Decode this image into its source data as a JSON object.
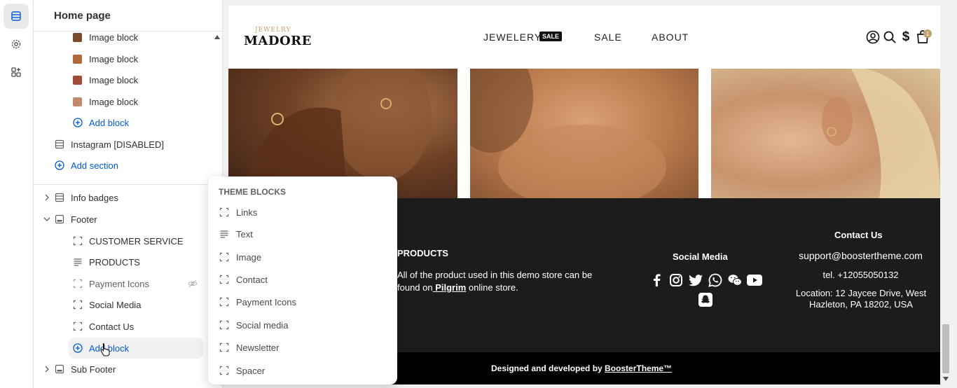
{
  "sidebar": {
    "title": "Home page",
    "image_blocks": [
      {
        "label": "Image block",
        "color": "#7a4a2a"
      },
      {
        "label": "Image block",
        "color": "#b0683a"
      },
      {
        "label": "Image block",
        "color": "#a34a36"
      },
      {
        "label": "Image block",
        "color": "#c08a6a"
      }
    ],
    "add_block_top": "Add block",
    "instagram": "Instagram [DISABLED]",
    "add_section": "Add section",
    "info_badges": "Info badges",
    "footer": "Footer",
    "footer_blocks": [
      {
        "label": "CUSTOMER SERVICE",
        "icon": "block-icon"
      },
      {
        "label": "PRODUCTS",
        "icon": "text-icon"
      },
      {
        "label": "Payment Icons",
        "icon": "block-icon",
        "hidden": true
      },
      {
        "label": "Social Media",
        "icon": "block-icon"
      },
      {
        "label": "Contact Us",
        "icon": "block-icon"
      }
    ],
    "add_block_footer": "Add block",
    "sub_footer": "Sub Footer"
  },
  "popup": {
    "title": "THEME BLOCKS",
    "items": [
      {
        "label": "Links",
        "icon": "block-icon"
      },
      {
        "label": "Text",
        "icon": "text-icon"
      },
      {
        "label": "Image",
        "icon": "block-icon"
      },
      {
        "label": "Contact",
        "icon": "block-icon"
      },
      {
        "label": "Payment Icons",
        "icon": "block-icon"
      },
      {
        "label": "Social media",
        "icon": "block-icon"
      },
      {
        "label": "Newsletter",
        "icon": "block-icon"
      },
      {
        "label": "Spacer",
        "icon": "block-icon"
      }
    ]
  },
  "store": {
    "logo_small": "JEWELRY",
    "logo_big": "MADORE",
    "nav": {
      "jewelery": "JEWELERY",
      "sale_badge": "SALE",
      "sale": "SALE",
      "about": "ABOUT"
    },
    "cart_count": "1",
    "footer": {
      "products_title": "PRODUCTS",
      "products_text_1": "All of the product used in this demo store can be",
      "products_text_2_prefix": "found on",
      "products_link": " Pilgrim",
      "products_text_2_suffix": " online store.",
      "social_title": "Social Media",
      "contact_title": "Contact Us",
      "email": "support@boostertheme.com",
      "phone": "tel. +12055050132",
      "location": "Location: 12 Jaycee Drive, West Hazleton, PA 18202, USA"
    },
    "subfooter": {
      "prefix": "Designed and developed by ",
      "link": "BoosterTheme™"
    }
  },
  "colors": {
    "accent": "#005bd3",
    "gold": "#c2a26a",
    "footer_bg": "#1c1c1c"
  }
}
